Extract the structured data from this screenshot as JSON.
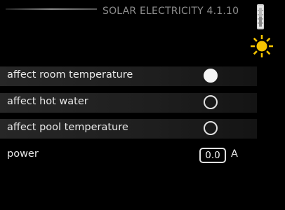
{
  "header": {
    "title": "SOLAR ELECTRICITY 4.1.10"
  },
  "icons": {
    "thermometer": "thermometer-icon",
    "sun": "sun-icon",
    "sun_color": "#f5c400"
  },
  "settings": {
    "affect_room_temperature": {
      "label": "affect room temperature",
      "checked": true
    },
    "affect_hot_water": {
      "label": "affect hot water",
      "checked": false
    },
    "affect_pool_temperature": {
      "label": "affect pool temperature",
      "checked": false
    },
    "power": {
      "label": "power",
      "value": "0.0",
      "unit": "A"
    }
  }
}
